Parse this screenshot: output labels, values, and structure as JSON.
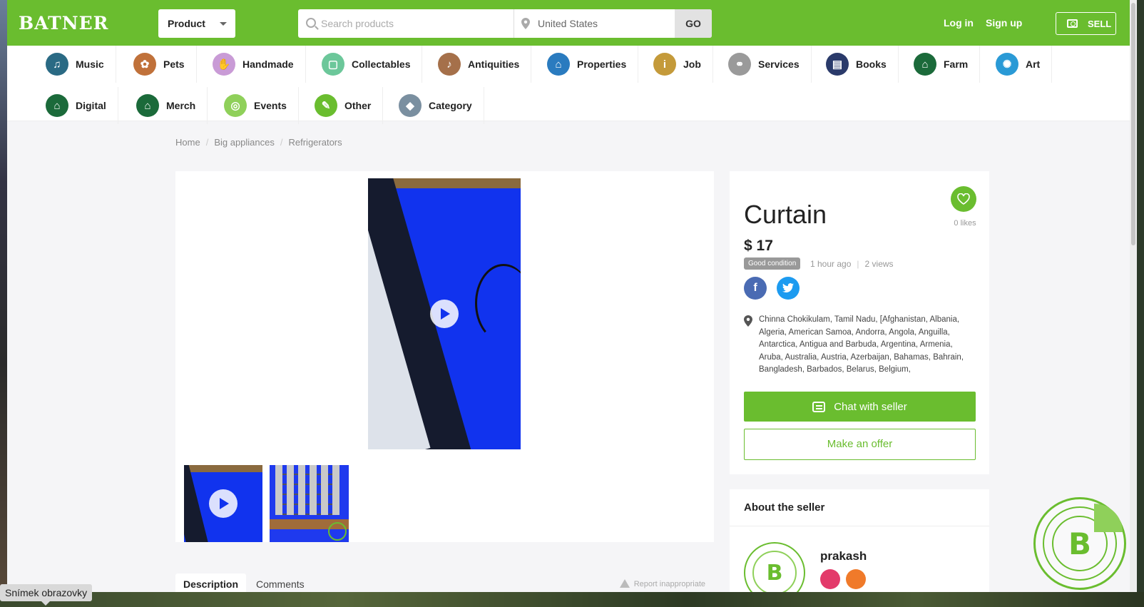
{
  "header": {
    "logo": "BATNER",
    "product_select": "Product",
    "search_placeholder": "Search products",
    "location": "United States",
    "go_label": "GO",
    "login": "Log in",
    "signup": "Sign up",
    "sell": "SELL",
    "brand_color": "#6abd2f"
  },
  "categories": [
    {
      "label": "Music",
      "icon": "music-icon",
      "color": "#2a6a84"
    },
    {
      "label": "Pets",
      "icon": "pets-icon",
      "color": "#c0713a"
    },
    {
      "label": "Handmade",
      "icon": "handmade-icon",
      "color": "#c99bd6"
    },
    {
      "label": "Collectables",
      "icon": "collectables-icon",
      "color": "#6cc79a"
    },
    {
      "label": "Antiquities",
      "icon": "antiquities-icon",
      "color": "#a5704a"
    },
    {
      "label": "Properties",
      "icon": "properties-icon",
      "color": "#2a7bbf"
    },
    {
      "label": "Job",
      "icon": "job-icon",
      "color": "#c49a3a"
    },
    {
      "label": "Services",
      "icon": "services-icon",
      "color": "#9a9a9a"
    },
    {
      "label": "Books",
      "icon": "books-icon",
      "color": "#2a3a6a"
    },
    {
      "label": "Farm",
      "icon": "farm-icon",
      "color": "#1b6a3a"
    },
    {
      "label": "Art",
      "icon": "art-icon",
      "color": "#2a9ad6"
    },
    {
      "label": "Digital",
      "icon": "digital-icon",
      "color": "#1b6a3a"
    },
    {
      "label": "Merch",
      "icon": "merch-icon",
      "color": "#1b6a3a"
    },
    {
      "label": "Events",
      "icon": "events-icon",
      "color": "#8fd05a"
    },
    {
      "label": "Other",
      "icon": "other-icon",
      "color": "#6abd2f"
    },
    {
      "label": "Category",
      "icon": "category-icon",
      "color": "#7a8fa0"
    }
  ],
  "breadcrumb": [
    "Home",
    "Big appliances",
    "Refrigerators"
  ],
  "product": {
    "title": "Curtain",
    "price": "$ 17",
    "condition": "Good condition",
    "posted": "1 hour ago",
    "views": "2 views",
    "likes": "0 likes",
    "location": "Chinna Chokikulam, Tamil Nadu, [Afghanistan, Albania, Algeria, American Samoa, Andorra, Angola, Anguilla, Antarctica, Antigua and Barbuda, Argentina, Armenia, Aruba, Australia, Austria, Azerbaijan, Bahamas, Bahrain, Bangladesh, Barbados, Belarus, Belgium,",
    "chat_label": "Chat with seller",
    "offer_label": "Make an offer"
  },
  "tabs": {
    "description": "Description",
    "comments": "Comments",
    "report": "Report inappropriate"
  },
  "seller": {
    "heading": "About the seller",
    "name": "prakash"
  },
  "tooltip": "Snímek obrazovky"
}
